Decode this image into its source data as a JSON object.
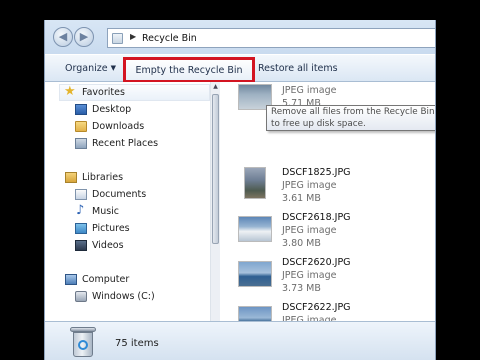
{
  "window": {
    "address": "Recycle Bin",
    "back_icon": "back-arrow-icon",
    "forward_icon": "forward-arrow-icon"
  },
  "toolbar": {
    "organize_label": "Organize",
    "empty_label": "Empty the Recycle Bin",
    "restore_label": "Restore all items",
    "highlight_color": "#d31421"
  },
  "tooltip": {
    "line1": "Remove all files from the Recycle Bin",
    "line2": "to free up disk space."
  },
  "navigation": {
    "favorites": {
      "label": "Favorites",
      "items": [
        {
          "label": "Desktop",
          "icon": "desktop-icon"
        },
        {
          "label": "Downloads",
          "icon": "downloads-folder-icon"
        },
        {
          "label": "Recent Places",
          "icon": "recent-places-icon"
        }
      ]
    },
    "libraries": {
      "label": "Libraries",
      "items": [
        {
          "label": "Documents",
          "icon": "documents-icon"
        },
        {
          "label": "Music",
          "icon": "music-icon"
        },
        {
          "label": "Pictures",
          "icon": "pictures-icon"
        },
        {
          "label": "Videos",
          "icon": "videos-icon"
        }
      ]
    },
    "computer": {
      "label": "Computer",
      "items": [
        {
          "label": "Windows (C:)",
          "icon": "drive-icon"
        }
      ]
    }
  },
  "files": [
    {
      "name": "",
      "type": "JPEG image",
      "size": "5.71 MB"
    },
    {
      "name": "DSCF1825.JPG",
      "type": "JPEG image",
      "size": "3.61 MB"
    },
    {
      "name": "DSCF2618.JPG",
      "type": "JPEG image",
      "size": "3.80 MB"
    },
    {
      "name": "DSCF2620.JPG",
      "type": "JPEG image",
      "size": "3.73 MB"
    },
    {
      "name": "DSCF2622.JPG",
      "type": "JPEG image",
      "size": ""
    }
  ],
  "status": {
    "item_count": "75 items"
  }
}
